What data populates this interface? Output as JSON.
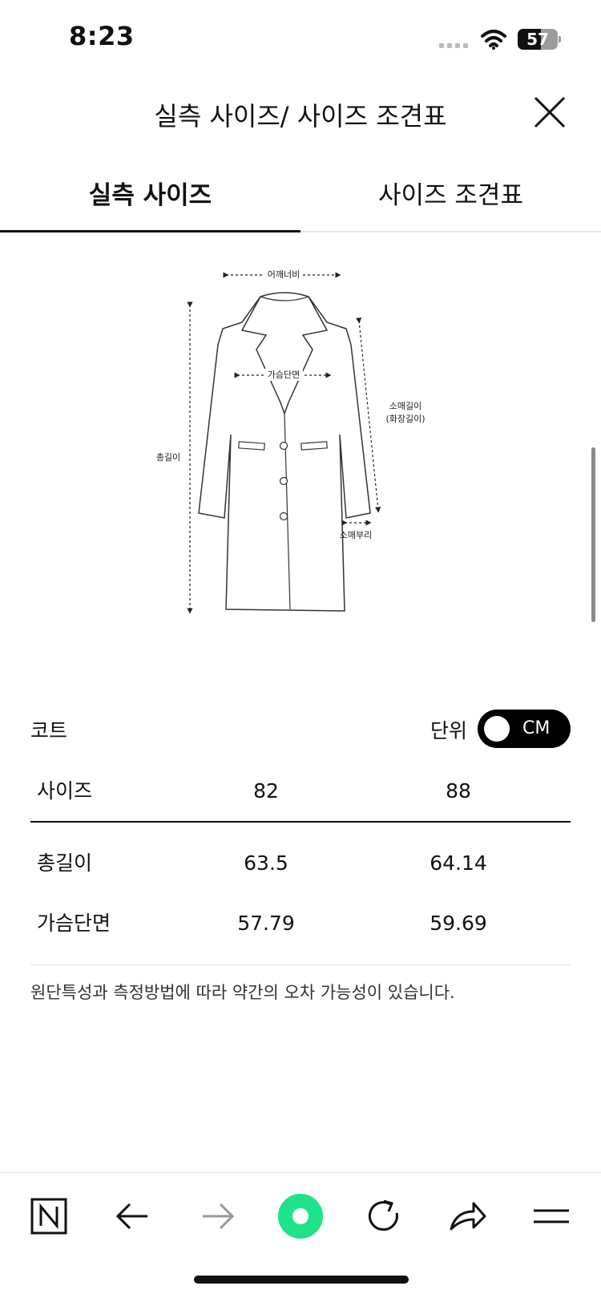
{
  "status_bar": {
    "time": "8:23",
    "battery": "57"
  },
  "header": {
    "title": "실측 사이즈/ 사이즈 조견표",
    "close_icon": "close-icon"
  },
  "tabs": [
    {
      "label": "실측 사이즈",
      "active": true
    },
    {
      "label": "사이즈 조견표",
      "active": false
    }
  ],
  "diagram": {
    "shoulder": "어깨너비",
    "chest": "가슴단면",
    "sleeve_length": "소매길이",
    "sleeve_length_alt": "(화장길이)",
    "total_length": "총길이",
    "cuff": "소매부리"
  },
  "size_section": {
    "title": "코트",
    "unit_label": "단위",
    "unit_value": "CM",
    "headers": [
      "사이즈",
      "82",
      "88"
    ],
    "rows": [
      [
        "총길이",
        "63.5",
        "64.14"
      ],
      [
        "가슴단면",
        "57.79",
        "59.69"
      ]
    ],
    "note": "원단특성과 측정방법에 따라 약간의 오차 가능성이 있습니다."
  },
  "bottom_nav": {
    "icons": [
      "naver-icon",
      "back-arrow-icon",
      "forward-arrow-icon",
      "green-dot-icon",
      "refresh-icon",
      "share-icon",
      "menu-icon"
    ],
    "accent_color": "#1ee38a"
  }
}
